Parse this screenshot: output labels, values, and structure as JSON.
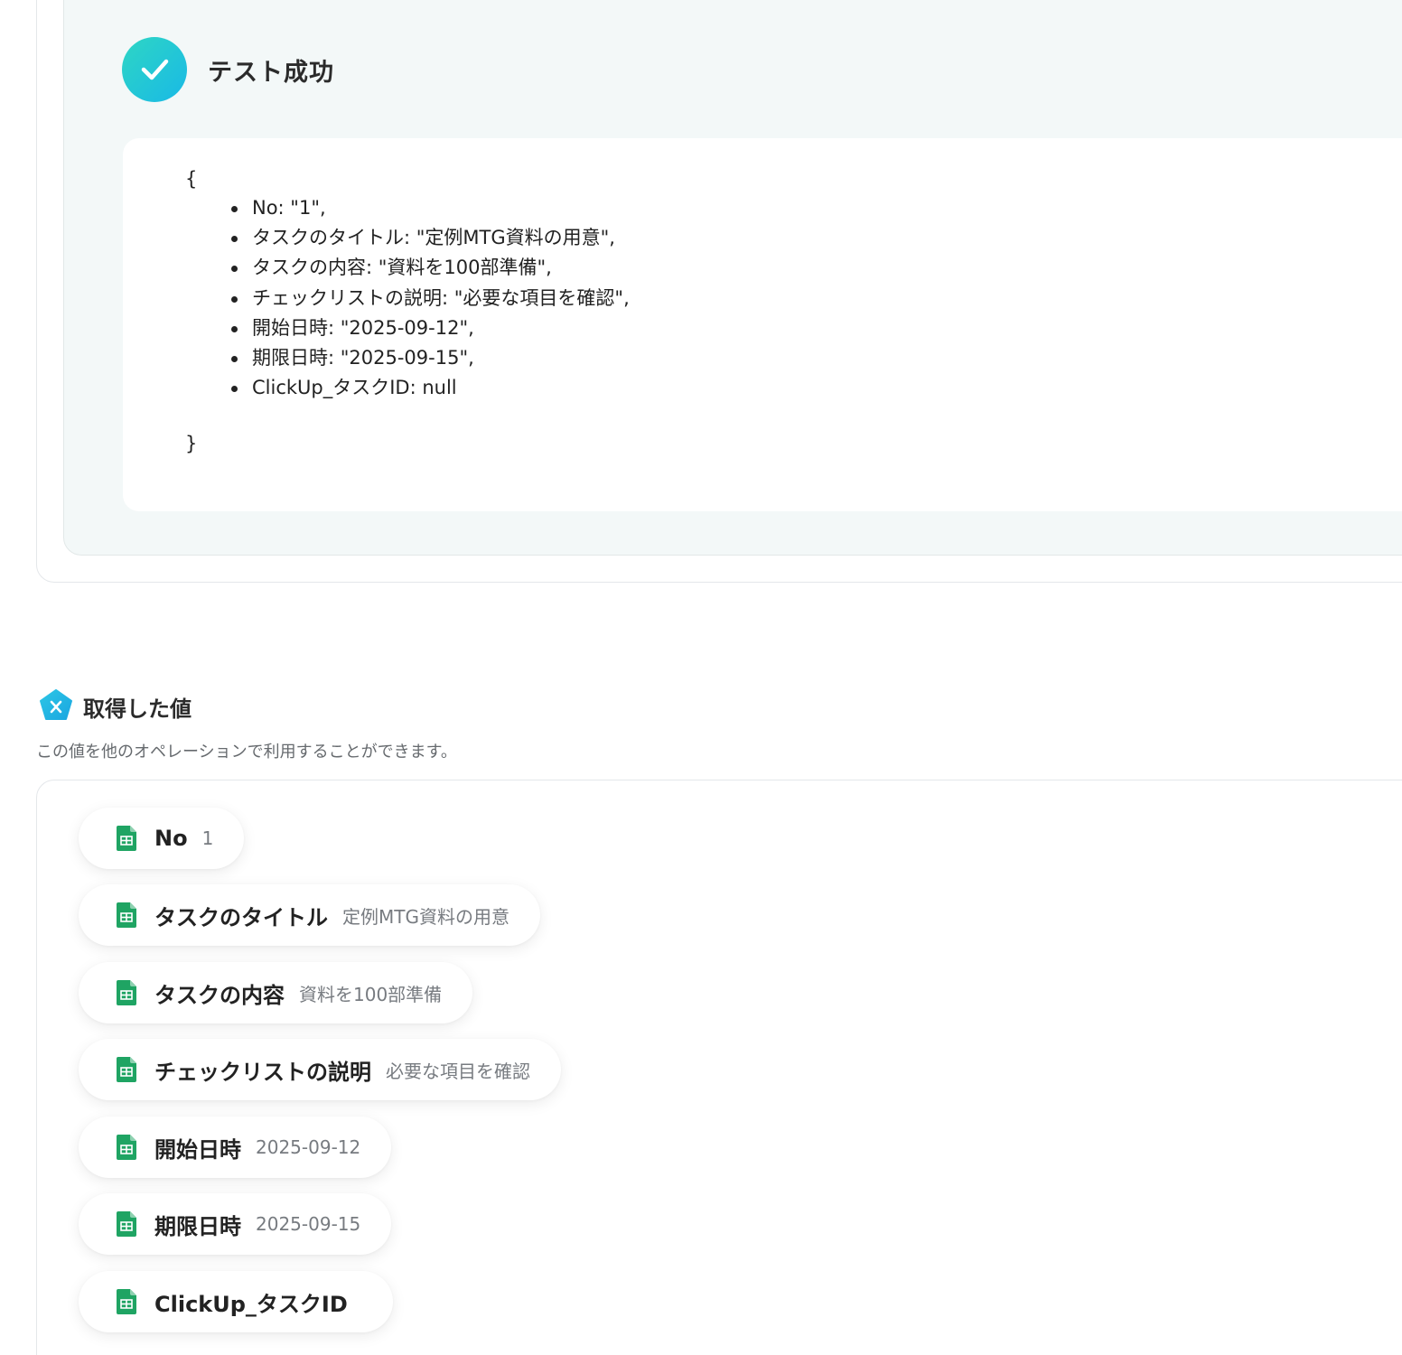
{
  "test_result": {
    "title": "テスト成功",
    "icon": "check-icon",
    "brace_open": "{",
    "brace_close": "}",
    "lines": [
      "No: \"1\",",
      "タスクのタイトル: \"定例MTG資料の用意\",",
      "タスクの内容: \"資料を100部準備\",",
      "チェックリストの説明: \"必要な項目を確認\",",
      "開始日時: \"2025-09-12\",",
      "期限日時: \"2025-09-15\",",
      "ClickUp_タスクID: null"
    ]
  },
  "acquired_values": {
    "title": "取得した値",
    "icon": "variable-icon",
    "description": "この値を他のオペレーションで利用することができます。",
    "items": [
      {
        "label": "No",
        "value": "1"
      },
      {
        "label": "タスクのタイトル",
        "value": "定例MTG資料の用意"
      },
      {
        "label": "タスクの内容",
        "value": "資料を100部準備"
      },
      {
        "label": "チェックリストの説明",
        "value": "必要な項目を確認"
      },
      {
        "label": "開始日時",
        "value": "2025-09-12"
      },
      {
        "label": "期限日時",
        "value": "2025-09-15"
      },
      {
        "label": "ClickUp_タスクID",
        "value": ""
      }
    ]
  },
  "colors": {
    "success_gradient_start": "#2ed6c4",
    "success_gradient_end": "#19b9e6",
    "sheets_green": "#1fa463",
    "panel_background": "#f3f8f8"
  }
}
